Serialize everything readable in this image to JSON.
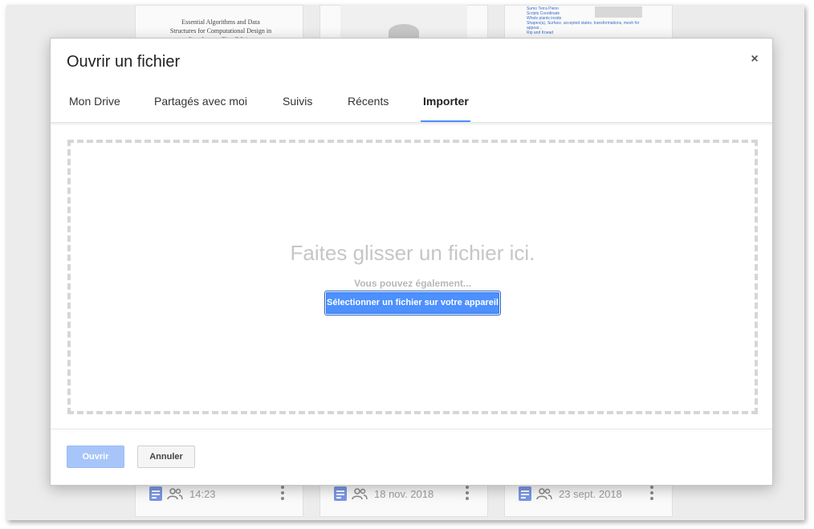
{
  "background_files": [
    {
      "thumbnail_text": [
        "Essential Algorithms and Data",
        "Structures for Computational Design in",
        "Grasshopper First Edition"
      ],
      "modified": "14:23"
    },
    {
      "modified": "18 nov. 2018"
    },
    {
      "thumbnail_links": [
        "Sumo Terra Pieno",
        "Scripts Coordinate",
        "Whole plants inside",
        "Shapes(a), Surface, accepted states, transformations, mesh for appear...",
        "Rip and Knead"
      ],
      "modified": "23 sept. 2018"
    }
  ],
  "dialog": {
    "title": "Ouvrir un fichier",
    "close_label": "×",
    "tabs": [
      {
        "label": "Mon Drive"
      },
      {
        "label": "Partagés avec moi"
      },
      {
        "label": "Suivis"
      },
      {
        "label": "Récents"
      },
      {
        "label": "Importer"
      }
    ],
    "active_tab": "Importer",
    "dropzone": {
      "title": "Faites glisser un fichier ici.",
      "subtitle": "Vous pouvez également...",
      "select_button": "Sélectionner un fichier sur votre appareil"
    },
    "footer": {
      "open_label": "Ouvrir",
      "cancel_label": "Annuler"
    }
  },
  "colors": {
    "accent": "#4d90fe",
    "disabled_button": "#a7c5f9",
    "doc_icon": "#5b7fe0"
  }
}
